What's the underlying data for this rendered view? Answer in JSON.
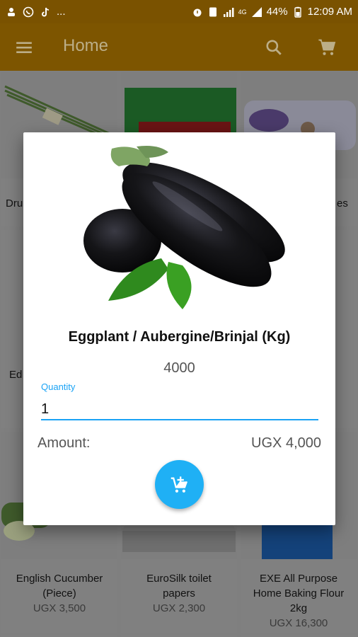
{
  "status_bar": {
    "time": "12:09 AM",
    "battery": "44%",
    "overflow": "...",
    "network": "4G"
  },
  "app_bar": {
    "title": "Home"
  },
  "grid": {
    "partial_labels": [
      "Dru",
      "es",
      "Ed"
    ],
    "products": [
      {
        "name": "English Cucumber (Piece)",
        "price": "UGX 3,500"
      },
      {
        "name": "EuroSilk toilet papers",
        "price": "UGX 2,300"
      },
      {
        "name": "EXE All Purpose Home Baking Flour 2kg",
        "price": "UGX 16,300"
      }
    ]
  },
  "dialog": {
    "product_name": "Eggplant / Aubergine/Brinjal (Kg)",
    "unit_price": "4000",
    "quantity_label": "Quantity",
    "quantity_value": "1",
    "amount_label": "Amount:",
    "amount_value": "UGX 4,000"
  },
  "colors": {
    "accent": "#1fb0f5",
    "app_bar": "#7d5500",
    "status_bar": "#7a5200"
  },
  "icons": {
    "menu": "menu-icon",
    "search": "search-icon",
    "cart": "cart-icon",
    "add_to_cart": "add-to-cart-icon"
  }
}
